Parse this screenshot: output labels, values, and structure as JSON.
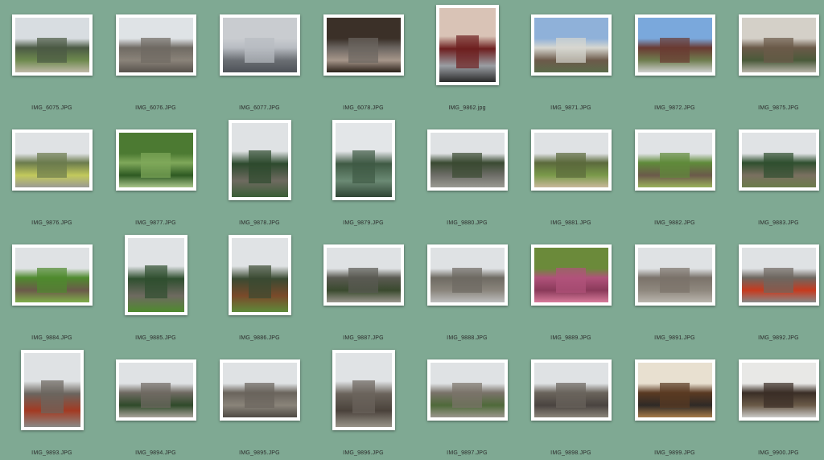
{
  "thumbnails": [
    {
      "filename": "IMG_6075.JPG",
      "orientation": "landscape",
      "palette": [
        "#d8dde1",
        "#4b5a44",
        "#6e8a4e",
        "#bfb9a8"
      ]
    },
    {
      "filename": "IMG_6076.JPG",
      "orientation": "landscape",
      "palette": [
        "#dfe3e6",
        "#6f6a63",
        "#8a8379",
        "#58524c"
      ]
    },
    {
      "filename": "IMG_6077.JPG",
      "orientation": "landscape",
      "palette": [
        "#c9ccd0",
        "#b8bcc2",
        "#6a6e73",
        "#4e5258"
      ]
    },
    {
      "filename": "IMG_6078.JPG",
      "orientation": "landscape",
      "palette": [
        "#3b3028",
        "#6b6560",
        "#a6968a",
        "#2a2018"
      ]
    },
    {
      "filename": "IMG_9862.jpg",
      "orientation": "portrait",
      "palette": [
        "#d9c3b6",
        "#6d1f1f",
        "#9a9ea3",
        "#2a2a2a"
      ]
    },
    {
      "filename": "IMG_9871.JPG",
      "orientation": "landscape",
      "palette": [
        "#8fb1d9",
        "#d7d7d0",
        "#6c5a4a",
        "#5b6b4a"
      ]
    },
    {
      "filename": "IMG_9872.JPG",
      "orientation": "landscape",
      "palette": [
        "#7aa8dc",
        "#6a3a32",
        "#6f7d4f",
        "#cfcfcf"
      ]
    },
    {
      "filename": "IMG_9875.JPG",
      "orientation": "landscape",
      "palette": [
        "#d4d0c8",
        "#6b5a49",
        "#4a5a3a",
        "#b8b4aa"
      ]
    },
    {
      "filename": "IMG_9876.JPG",
      "orientation": "landscape",
      "palette": [
        "#dfe2e4",
        "#6b7b4d",
        "#c2c95c",
        "#9a9a94"
      ]
    },
    {
      "filename": "IMG_9877.JPG",
      "orientation": "landscape",
      "palette": [
        "#4c7a32",
        "#7fa85a",
        "#2e5a22",
        "#a8c58a"
      ]
    },
    {
      "filename": "IMG_9878.JPG",
      "orientation": "portrait",
      "palette": [
        "#dfe2e4",
        "#2d4a2e",
        "#6e6a60",
        "#3a5e36"
      ]
    },
    {
      "filename": "IMG_9879.JPG",
      "orientation": "portrait",
      "palette": [
        "#e3e6e8",
        "#3f5a44",
        "#6b8a74",
        "#2f4434"
      ]
    },
    {
      "filename": "IMG_9880.JPG",
      "orientation": "landscape",
      "palette": [
        "#dfe2e4",
        "#3a4a32",
        "#6e6e68",
        "#9a9a92"
      ]
    },
    {
      "filename": "IMG_9881.JPG",
      "orientation": "landscape",
      "palette": [
        "#dfe2e4",
        "#5b6a3c",
        "#7a9a4a",
        "#c8b89a"
      ]
    },
    {
      "filename": "IMG_9882.JPG",
      "orientation": "landscape",
      "palette": [
        "#e0e3e5",
        "#5f8a3a",
        "#6b5a4a",
        "#9ab05a"
      ]
    },
    {
      "filename": "IMG_9883.JPG",
      "orientation": "landscape",
      "palette": [
        "#e0e3e5",
        "#2f4f2f",
        "#7a7060",
        "#6b7b4a"
      ]
    },
    {
      "filename": "IMG_9884.JPG",
      "orientation": "landscape",
      "palette": [
        "#dfe2e4",
        "#4f8a2e",
        "#6b5a4a",
        "#7fae4a"
      ]
    },
    {
      "filename": "IMG_9885.JPG",
      "orientation": "portrait",
      "palette": [
        "#e0e3e5",
        "#2f4f2f",
        "#6e6a60",
        "#4f8a2e"
      ]
    },
    {
      "filename": "IMG_9886.JPG",
      "orientation": "portrait",
      "palette": [
        "#e0e3e5",
        "#3a4a32",
        "#7a4a2a",
        "#5f8a3a"
      ]
    },
    {
      "filename": "IMG_9887.JPG",
      "orientation": "landscape",
      "palette": [
        "#dfe2e4",
        "#5a5a52",
        "#3a4a2e",
        "#9a968e"
      ]
    },
    {
      "filename": "IMG_9888.JPG",
      "orientation": "landscape",
      "palette": [
        "#dfe2e4",
        "#6e6a62",
        "#8a857c",
        "#bdbdbd"
      ]
    },
    {
      "filename": "IMG_9889.JPG",
      "orientation": "landscape",
      "palette": [
        "#6b8a3a",
        "#b0527a",
        "#8a3a5a",
        "#d77a9a"
      ]
    },
    {
      "filename": "IMG_9891.JPG",
      "orientation": "landscape",
      "palette": [
        "#dfe2e4",
        "#7a726a",
        "#8f887e",
        "#b9b5ad"
      ]
    },
    {
      "filename": "IMG_9892.JPG",
      "orientation": "landscape",
      "palette": [
        "#dfe2e4",
        "#6d6760",
        "#c73a1e",
        "#888"
      ]
    },
    {
      "filename": "IMG_9893.JPG",
      "orientation": "portrait",
      "palette": [
        "#dfe2e4",
        "#6b655e",
        "#a33a22",
        "#8a8a86"
      ]
    },
    {
      "filename": "IMG_9894.JPG",
      "orientation": "landscape",
      "palette": [
        "#dfe2e4",
        "#6f6a62",
        "#2f4a2a",
        "#a8a39a"
      ]
    },
    {
      "filename": "IMG_9895.JPG",
      "orientation": "landscape",
      "palette": [
        "#dfe2e4",
        "#6a645c",
        "#8a847a",
        "#4f4a44"
      ]
    },
    {
      "filename": "IMG_9896.JPG",
      "orientation": "portrait",
      "palette": [
        "#e0e3e5",
        "#6b645c",
        "#4a423b",
        "#9a948a"
      ]
    },
    {
      "filename": "IMG_9897.JPG",
      "orientation": "landscape",
      "palette": [
        "#dfe2e4",
        "#7a736a",
        "#4f6a3a",
        "#9a968d"
      ]
    },
    {
      "filename": "IMG_9898.JPG",
      "orientation": "landscape",
      "palette": [
        "#dfe2e4",
        "#6a645c",
        "#4a4440",
        "#8a847a"
      ]
    },
    {
      "filename": "IMG_9899.JPG",
      "orientation": "landscape",
      "palette": [
        "#e8e0d0",
        "#5a3a22",
        "#2f2a26",
        "#a67a4a"
      ]
    },
    {
      "filename": "IMG_9900.JPG",
      "orientation": "landscape",
      "palette": [
        "#e8e8e6",
        "#3a2e26",
        "#6a5a48",
        "#c9c9c6"
      ]
    }
  ]
}
